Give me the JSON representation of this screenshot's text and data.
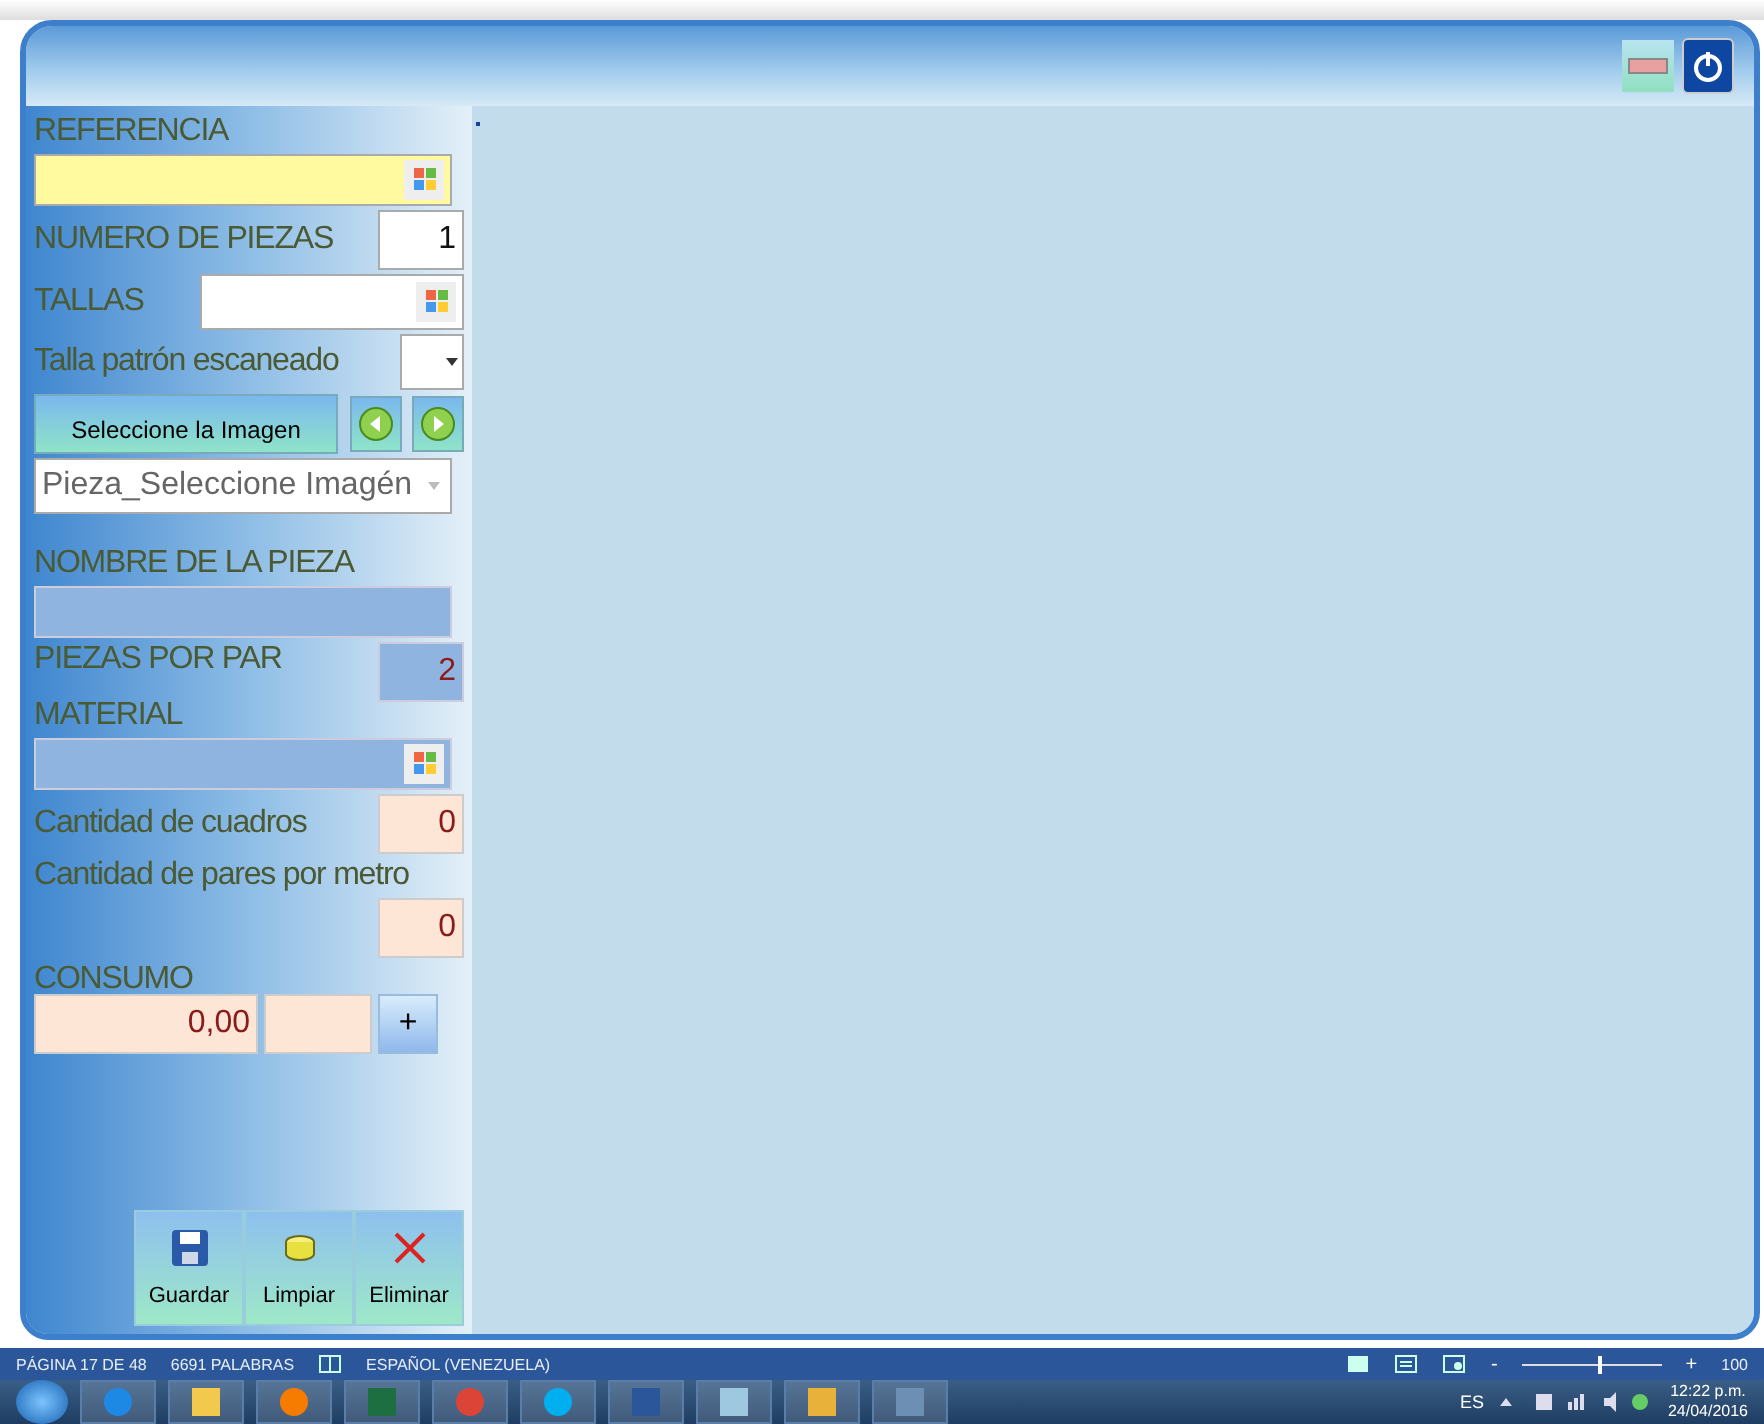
{
  "form": {
    "referencia": {
      "label": "REFERENCIA"
    },
    "numero_piezas": {
      "label": "NUMERO DE PIEZAS",
      "value": "1"
    },
    "tallas": {
      "label": "TALLAS"
    },
    "talla_patron": {
      "label": "Talla patrón escaneado"
    },
    "select_image_button": "Seleccione la Imagen",
    "pieza_dropdown": {
      "value": "Pieza_Seleccione Imagén",
      "disabled": true
    },
    "nombre_pieza": {
      "label": "NOMBRE DE LA PIEZA"
    },
    "piezas_por_par": {
      "label": "PIEZAS POR PAR",
      "value": "2"
    },
    "material": {
      "label": "MATERIAL"
    },
    "cantidad_cuadros": {
      "label": "Cantidad de cuadros",
      "value": "0"
    },
    "pares_por_metro": {
      "label": "Cantidad de pares por metro",
      "value": "0"
    },
    "consumo": {
      "label": "CONSUMO",
      "value": "0,00",
      "add_button": "+"
    }
  },
  "actions": [
    {
      "label": "Guardar",
      "kind": "save"
    },
    {
      "label": "Limpiar",
      "kind": "clear"
    },
    {
      "label": "Eliminar",
      "kind": "delete"
    }
  ],
  "status_bar": {
    "page": "PÁGINA 17 DE 48",
    "words": "6691 PALABRAS",
    "language": "ESPAÑOL (VENEZUELA)",
    "zoom_minus": "-",
    "zoom_plus": "+",
    "zoom": "100",
    "level": 0.55
  },
  "taskbar": {
    "apps": [
      {
        "kind": "ie",
        "color": "#1e88e5"
      },
      {
        "kind": "folder",
        "color": "#f2c94c"
      },
      {
        "kind": "media",
        "color": "#f57c00"
      },
      {
        "kind": "excel",
        "color": "#1d6f42"
      },
      {
        "kind": "chrome",
        "color": "#db4437"
      },
      {
        "kind": "skype",
        "color": "#00aff0"
      },
      {
        "kind": "word",
        "color": "#2b579a"
      },
      {
        "kind": "notepad",
        "color": "#9ec8e0"
      },
      {
        "kind": "picture",
        "color": "#e8b23a"
      },
      {
        "kind": "network",
        "color": "#6c8fb3"
      }
    ],
    "language": "ES",
    "time": "12:22 p.m.",
    "date": "24/04/2016"
  }
}
